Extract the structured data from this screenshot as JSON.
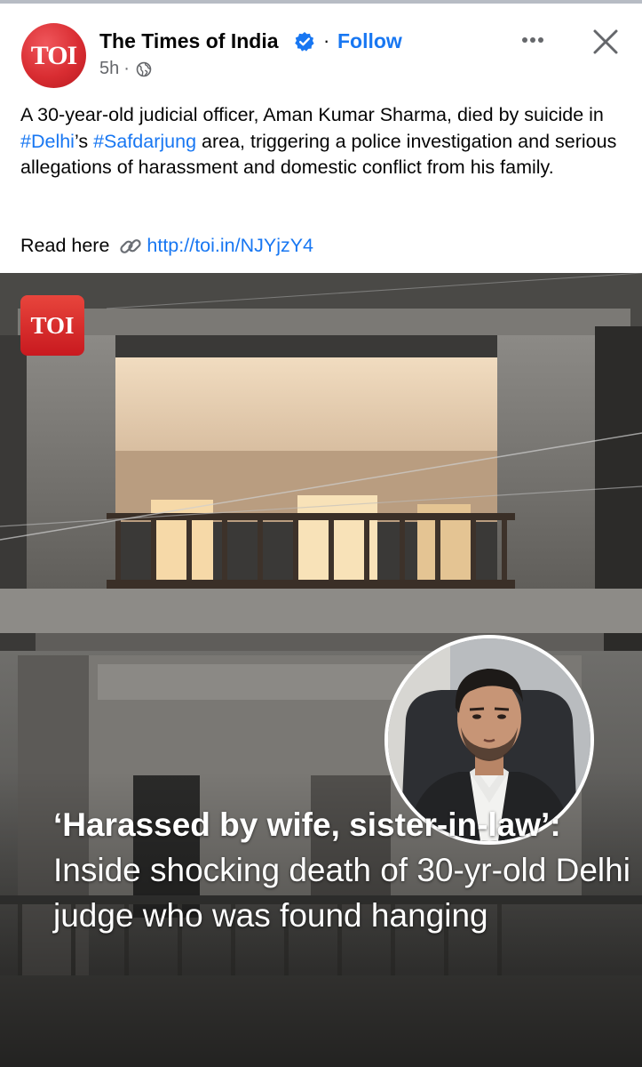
{
  "post": {
    "page_name": "The Times of India",
    "avatar_text": "TOI",
    "follow_label": "Follow",
    "dot": "·",
    "time": "5h",
    "audience_icon": "globe-icon",
    "caption_part1": "A 30-year-old judicial officer, Aman Kumar Sharma, died by suicide in ",
    "hashtag1": "#Delhi",
    "caption_part2": "’s ",
    "hashtag2": "#Safdarjung",
    "caption_part3": " area, triggering a police investigation and serious allegations of harassment and domestic conflict from his family.",
    "read_here": "Read here",
    "link": "http://toi.in/NJYjzY4"
  },
  "image": {
    "badge_text": "TOI",
    "headline_bold": "‘Harassed by wife, sister-in-law’:",
    "headline_rest": " Inside shocking death of 30-yr-old Delhi judge who was found hanging"
  },
  "colors": {
    "link_blue": "#1877f2",
    "toi_red": "#d92d32",
    "meta_grey": "#65676b"
  }
}
